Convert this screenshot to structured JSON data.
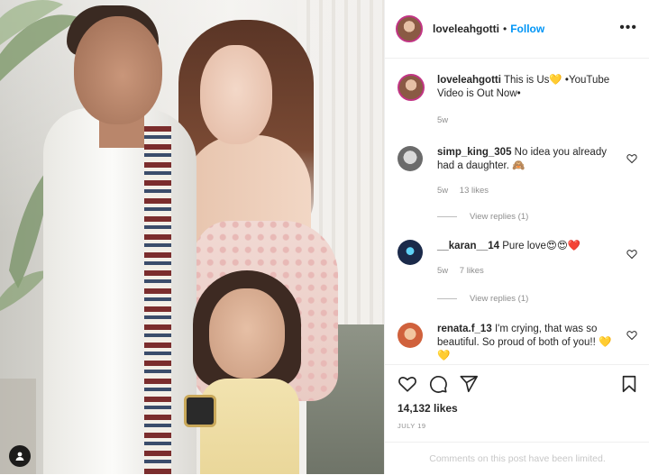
{
  "post": {
    "username": "loveleahgotti",
    "follow_label": "Follow",
    "separator": "•",
    "more_label": "•••",
    "caption_user": "loveleahgotti",
    "caption_text": "This is Us💛 •YouTube Video is Out Now•",
    "caption_time": "5w",
    "likes": "14,132 likes",
    "date": "JULY 19",
    "comments_limited": "Comments on this post have been limited."
  },
  "comments": [
    {
      "user": "simp_king_305",
      "text": "No idea you already had a daughter. 🙈",
      "time": "5w",
      "likes": "13 likes",
      "view_replies": "View replies (1)"
    },
    {
      "user": "__karan__14",
      "text": "Pure love😍😍❤️",
      "time": "5w",
      "likes": "7 likes",
      "view_replies": "View replies (1)"
    },
    {
      "user": "renata.f_13",
      "text": "I'm crying, that was so beautiful. So proud of both of you!! 💛💛"
    }
  ],
  "icons": {
    "like": "heart-icon",
    "comment": "comment-bubble-icon",
    "share": "paper-plane-icon",
    "save": "bookmark-icon",
    "tag": "user-tag-icon",
    "more": "more-options-icon"
  },
  "colors": {
    "follow": "#0095f6",
    "story_ring": "#c13584",
    "muted": "#8e8e8e"
  }
}
